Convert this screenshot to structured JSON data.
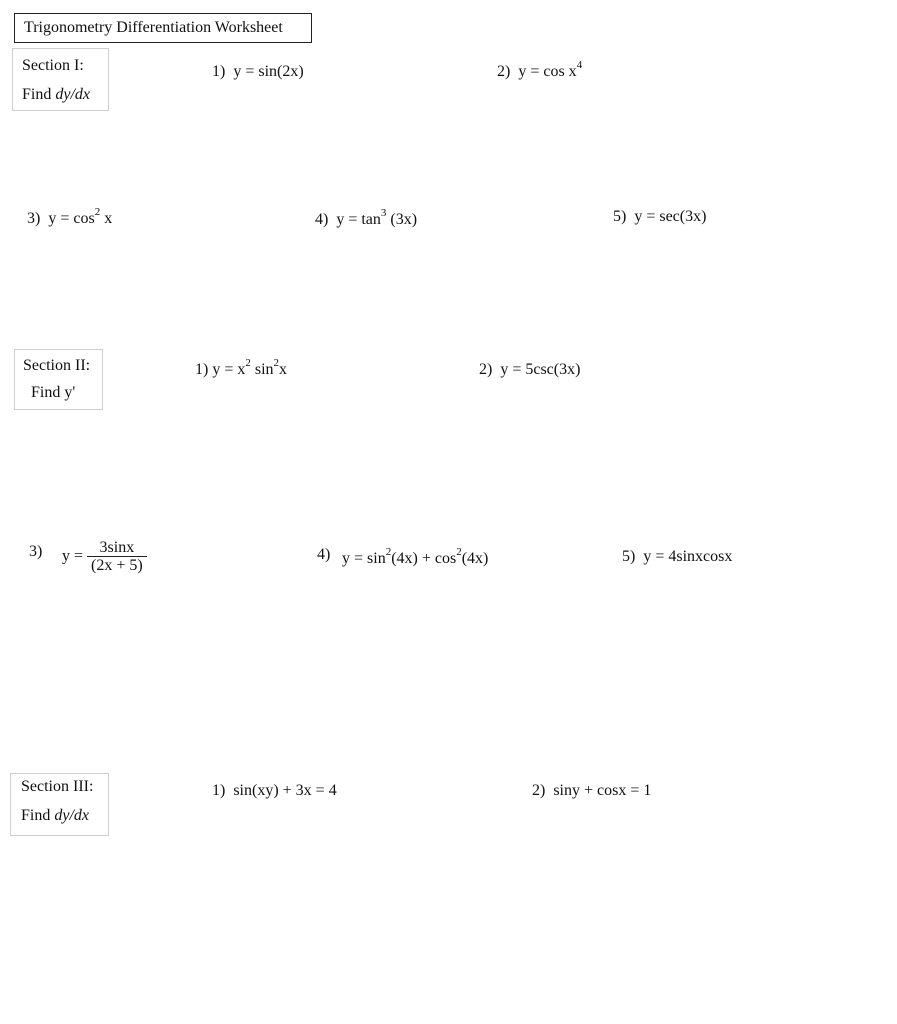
{
  "title": "Trigonometry Differentiation Worksheet",
  "sections": [
    {
      "heading": "Section I:",
      "instruction_prefix": "Find ",
      "instruction_var": "dy/dx",
      "problems": [
        {
          "num": "1)",
          "lhs": "y = sin(2x)"
        },
        {
          "num": "2)",
          "lhs": "y = cos x",
          "sup": "4"
        },
        {
          "num": "3)",
          "lhs": "y = cos",
          "sup": "2",
          "rhs": " x"
        },
        {
          "num": "4)",
          "lhs": "y = tan",
          "sup": "3",
          "rhs": " (3x)"
        },
        {
          "num": "5)",
          "lhs": "y = sec(3x)"
        }
      ]
    },
    {
      "heading": "Section II:",
      "instruction": "Find y'",
      "problems": [
        {
          "num": "1)",
          "lhs": "y =  x",
          "sup": "2",
          "mid": " sin",
          "sup2": "2",
          "rhs": "x"
        },
        {
          "num": "2)",
          "lhs": "y = 5csc(3x)"
        },
        {
          "num": "3)",
          "lhs": "y =",
          "numerator": "3sinx",
          "denominator": "(2x + 5)"
        },
        {
          "num": "4)",
          "lhs": "y =  sin",
          "sup": "2",
          "mid": "(4x) + cos",
          "sup2": "2",
          "rhs": "(4x)"
        },
        {
          "num": "5)",
          "lhs": "y = 4sinxcosx"
        }
      ]
    },
    {
      "heading": "Section III:",
      "instruction_prefix": "Find ",
      "instruction_var": "dy/dx",
      "problems": [
        {
          "num": "1)",
          "lhs": "sin(xy) + 3x = 4"
        },
        {
          "num": "2)",
          "lhs": "siny + cosx = 1"
        }
      ]
    }
  ]
}
